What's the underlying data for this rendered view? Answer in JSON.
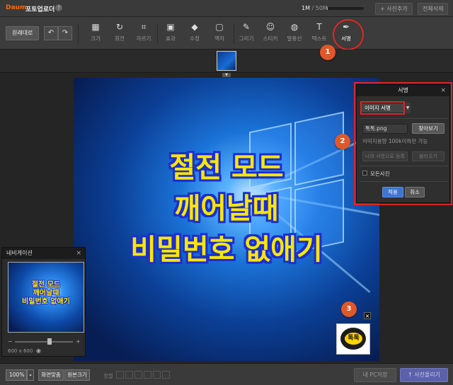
{
  "app": {
    "logo": "Daum",
    "title": "포토업로더",
    "help": "?"
  },
  "storage": {
    "used": "1M",
    "total": "/ 50M",
    "fraction": 0.02
  },
  "top_buttons": {
    "add_photo": "+ 사진추가",
    "delete_all": "전체삭제"
  },
  "toolbar": {
    "original": "원래대로",
    "undo": "↶",
    "redo": "↷",
    "tools": [
      {
        "label": "크기",
        "icon": "▦"
      },
      {
        "label": "회전",
        "icon": "↻"
      },
      {
        "label": "자르기",
        "icon": "⌗"
      },
      {
        "label": "효과",
        "icon": "▣"
      },
      {
        "label": "수정",
        "icon": "◆"
      },
      {
        "label": "액자",
        "icon": "▢"
      },
      {
        "label": "그리기",
        "icon": "✎"
      },
      {
        "label": "스티커",
        "icon": "☺"
      },
      {
        "label": "말풍선",
        "icon": "◍"
      },
      {
        "label": "텍스트",
        "icon": "T"
      },
      {
        "label": "서명",
        "icon": "✒"
      }
    ]
  },
  "canvas": {
    "lines": [
      "절전 모드",
      "깨어날때",
      "비밀번호 없애기"
    ],
    "signature_text": "톡톡",
    "signature_close": "×"
  },
  "signature_panel": {
    "title": "서명",
    "close": "×",
    "select_value": "이미지 서명",
    "file_value": "톡톡.png",
    "browse": "찾아보기",
    "limit_text": "이미지용량 100k이하만 가능",
    "register": "나의 서명으로 등록",
    "load": "불러오기",
    "all_photos": "모든사진",
    "apply": "적용",
    "cancel": "취소"
  },
  "markers": [
    "1",
    "2",
    "3"
  ],
  "navigation": {
    "title": "네비게이션",
    "close": "×",
    "lines": [
      "절전 모드",
      "깨어날때",
      "비밀번호 없애기"
    ],
    "minus": "−",
    "plus": "+",
    "size": "600 x 600",
    "zoom_fraction": 0.6
  },
  "bottom": {
    "zoom": "100%",
    "zoom_dd": "▴",
    "fit_screen": "화면맞춤",
    "original_size": "원본크기",
    "align_label": "정렬",
    "save_pc": "내 PC저장",
    "upload": "↑ 사진올리기"
  },
  "colors": {
    "headline_fill": "#ffe600",
    "headline_stroke": "#1b2fd0",
    "highlight_red": "#d8262a",
    "marker": "#e0572a",
    "apply_blue": "#3e74d6"
  }
}
